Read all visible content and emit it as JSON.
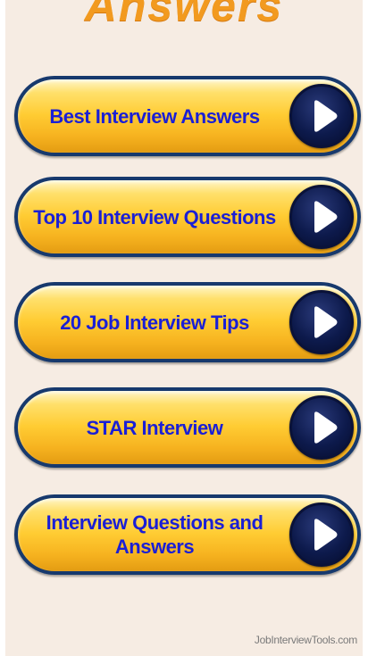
{
  "header": {
    "title": "Answers"
  },
  "menu": {
    "items": [
      {
        "label": "Best Interview Answers"
      },
      {
        "label": "Top 10 Interview Questions"
      },
      {
        "label": "20 Job Interview Tips"
      },
      {
        "label": "STAR Interview"
      },
      {
        "label": "Interview Questions and Answers"
      }
    ],
    "arrow_icon": "play-arrow-icon"
  },
  "footer": {
    "site_name": "JobInterviewTools.com"
  },
  "colors": {
    "page_background": "#f6ece3",
    "heading": "#f29a1f",
    "button_fill": "#ffcc33",
    "button_border": "#17396d",
    "button_text": "#1a1fd6",
    "arrow_circle": "#0d1a4c",
    "arrow_glyph": "#ffffff",
    "footer_text": "#7a7a7a"
  }
}
